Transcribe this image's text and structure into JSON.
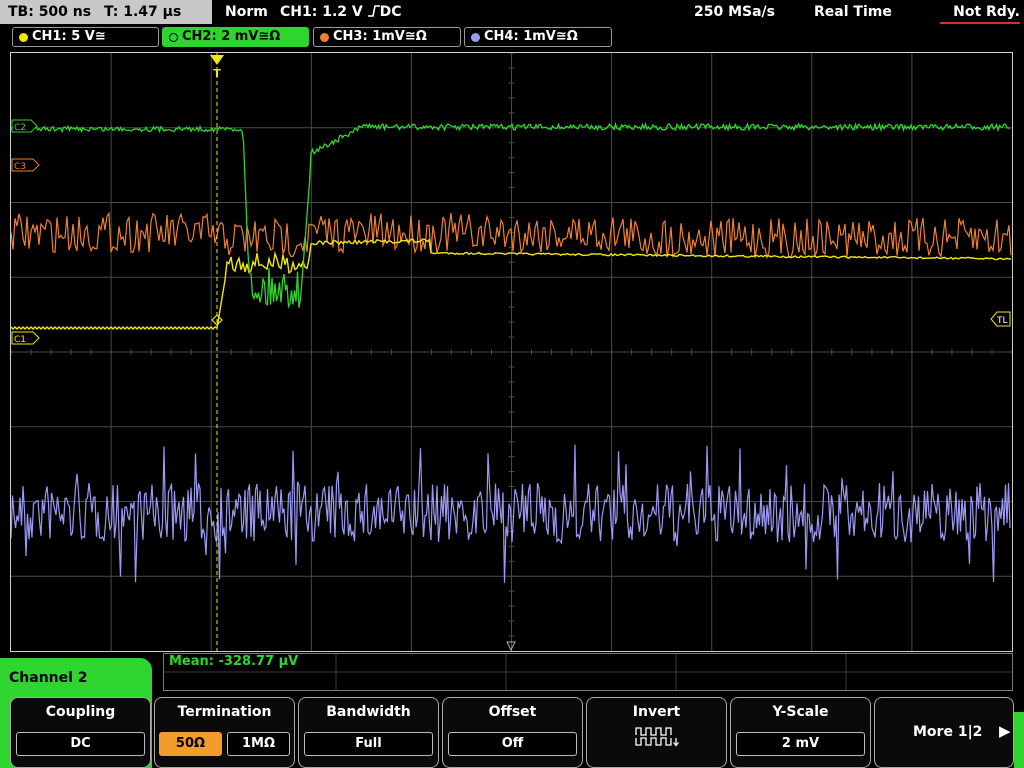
{
  "status_bar": {
    "timebase": "TB: 500 ns",
    "trigger_time": "T: 1.47 µs",
    "trigger_mode": "Norm",
    "trigger_source": "CH1: 1.2 V",
    "trigger_coupling": "DC",
    "sample_rate": "250 MSa/s",
    "acq_mode": "Real Time",
    "state": "Not Rdy."
  },
  "channel_tabs": [
    {
      "label": "CH1: 5 V≅",
      "color": "#f2e70c"
    },
    {
      "label": "CH2: 2 mV≅Ω",
      "color": "#2fd42f"
    },
    {
      "label": "CH3: 1mV≅Ω",
      "color": "#f08030"
    },
    {
      "label": "CH4: 1mV≅Ω",
      "color": "#9a9af5"
    }
  ],
  "markers": {
    "c2": "C2",
    "c3": "C3",
    "c1": "C1",
    "trigger_level": "TL",
    "trigger": "T"
  },
  "colors": {
    "ch1": "#f2e70c",
    "ch2": "#2fd42f",
    "ch3": "#f08030",
    "ch4": "#9a9af5",
    "grid": "#5a5a5a"
  },
  "measurement": "Mean: -328.77 µV",
  "menu": {
    "channel_label": "Channel 2",
    "coupling": {
      "title": "Coupling",
      "value": "DC"
    },
    "termination": {
      "title": "Termination",
      "opt1": "50Ω",
      "opt2": "1MΩ"
    },
    "bandwidth": {
      "title": "Bandwidth",
      "value": "Full"
    },
    "offset": {
      "title": "Offset",
      "value": "Off"
    },
    "invert": {
      "title": "Invert"
    },
    "yscale": {
      "title": "Y-Scale",
      "value": "2 mV"
    },
    "more": "More 1|2",
    "more_arrow": "▶"
  }
}
